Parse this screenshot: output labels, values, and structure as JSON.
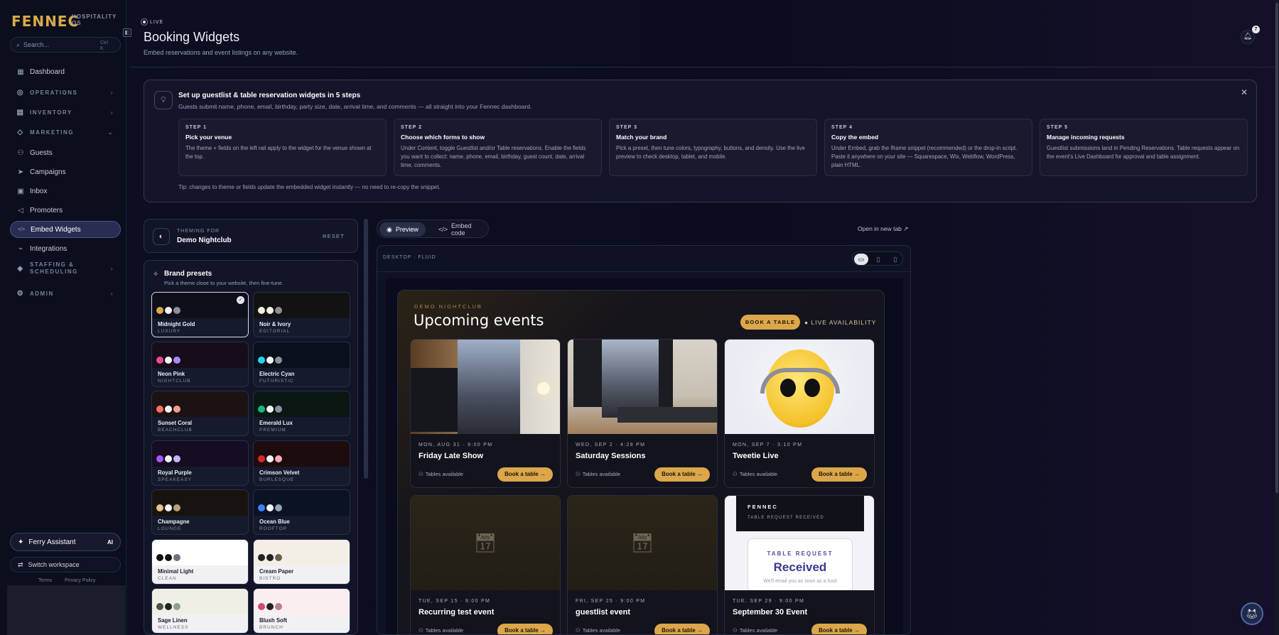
{
  "brand": {
    "logo": "FENNEC",
    "sub_line1": "HOSPITALITY",
    "sub_line2": "OS"
  },
  "search": {
    "placeholder": "Search...",
    "shortcut_line1": "Ctrl",
    "shortcut_line2": "K"
  },
  "sidebar": {
    "items": [
      {
        "label": "Dashboard",
        "icon": "grid-icon",
        "type": "item"
      },
      {
        "label": "OPERATIONS",
        "icon": "operations-icon",
        "type": "section"
      },
      {
        "label": "INVENTORY",
        "icon": "inventory-icon",
        "type": "section"
      },
      {
        "label": "MARKETING",
        "icon": "marketing-icon",
        "type": "section"
      },
      {
        "label": "Guests",
        "icon": "users-icon",
        "type": "item"
      },
      {
        "label": "Campaigns",
        "icon": "send-icon",
        "type": "item"
      },
      {
        "label": "Inbox",
        "icon": "inbox-icon",
        "type": "item"
      },
      {
        "label": "Promoters",
        "icon": "megaphone-icon",
        "type": "item"
      },
      {
        "label": "Embed Widgets",
        "icon": "code-icon",
        "type": "item",
        "active": true
      },
      {
        "label": "Integrations",
        "icon": "plug-icon",
        "type": "item"
      },
      {
        "label": "STAFFING &",
        "label2": "SCHEDULING",
        "icon": "staff-icon",
        "type": "section"
      },
      {
        "label": "ADMIN",
        "icon": "admin-icon",
        "type": "section"
      }
    ],
    "assistant": "Ferry Assistant",
    "assistant_badge": "AI",
    "switch": "Switch workspace",
    "terms": "Terms",
    "privacy": "Privacy Policy"
  },
  "header": {
    "live": "LIVE",
    "title": "Booking Widgets",
    "subtitle": "Embed reservations and event listings on any website.",
    "notifications": "7"
  },
  "setup": {
    "title": "Set up guestlist & table reservation widgets in 5 steps",
    "subtitle": "Guests submit name, phone, email, birthday, party size, date, arrival time, and comments — all straight into your Fennec dashboard.",
    "steps": [
      {
        "num": "STEP 1",
        "title": "Pick your venue",
        "desc": "The theme + fields on the left rail apply to the widget for the venue shown at the top."
      },
      {
        "num": "STEP 2",
        "title": "Choose which forms to show",
        "desc": "Under Content, toggle Guestlist and/or Table reservations. Enable the fields you want to collect: name, phone, email, birthday, guest count, date, arrival time, comments."
      },
      {
        "num": "STEP 3",
        "title": "Match your brand",
        "desc": "Pick a preset, then tune colors, typography, buttons, and density. Use the live preview to check desktop, tablet, and mobile."
      },
      {
        "num": "STEP 4",
        "title": "Copy the embed",
        "desc": "Under Embed, grab the Iframe snippet (recommended) or the drop-in script. Paste it anywhere on your site — Squarespace, Wix, Webflow, WordPress, plain HTML."
      },
      {
        "num": "STEP 5",
        "title": "Manage incoming requests",
        "desc": "Guestlist submissions land in Pending Reservations. Table requests appear on the event's Live Dashboard for approval and table assignment."
      }
    ],
    "tip": "Tip: changes to theme or fields update the embedded widget instantly — no need to re-copy the snippet."
  },
  "theming": {
    "label": "THEMING FOR",
    "venue": "Demo Nightclub",
    "reset": "RESET"
  },
  "presets": {
    "title": "Brand presets",
    "subtitle": "Pick a theme close to your website, then fine-tune.",
    "items": [
      {
        "name": "Midnight Gold",
        "tag": "LUXURY",
        "bg": "#0d0f1a",
        "colors": [
          "#d9a94a",
          "#f2f2f2",
          "#8c8f9c"
        ],
        "selected": true
      },
      {
        "name": "Noir & Ivory",
        "tag": "EDITORIAL",
        "bg": "#121212",
        "colors": [
          "#f3efe2",
          "#f3efe2",
          "#8f8f8f"
        ]
      },
      {
        "name": "Neon Pink",
        "tag": "NIGHTCLUB",
        "bg": "#170d1a",
        "colors": [
          "#ec4899",
          "#f2f2f2",
          "#a78bfa"
        ]
      },
      {
        "name": "Electric Cyan",
        "tag": "FUTURISTIC",
        "bg": "#0a0f1c",
        "colors": [
          "#22d3ee",
          "#f2f2f2",
          "#8c8f9c"
        ]
      },
      {
        "name": "Sunset Coral",
        "tag": "BEACHCLUB",
        "bg": "#1d1213",
        "colors": [
          "#f97360",
          "#f2f2f2",
          "#f0a090"
        ]
      },
      {
        "name": "Emerald Lux",
        "tag": "PREMIUM",
        "bg": "#0b1712",
        "colors": [
          "#10b981",
          "#f2f2f2",
          "#8c8f9c"
        ]
      },
      {
        "name": "Royal Purple",
        "tag": "SPEAKEASY",
        "bg": "#150d22",
        "colors": [
          "#a855f7",
          "#f2f2f2",
          "#c4b5fd"
        ]
      },
      {
        "name": "Crimson Velvet",
        "tag": "BURLESQUE",
        "bg": "#1d0c0e",
        "colors": [
          "#dc2626",
          "#f2f2f2",
          "#f9a8b4"
        ]
      },
      {
        "name": "Champagne",
        "tag": "LOUNGE",
        "bg": "#17140f",
        "colors": [
          "#e8c48a",
          "#f2f2f2",
          "#b7a07a"
        ]
      },
      {
        "name": "Ocean Blue",
        "tag": "ROOFTOP",
        "bg": "#0b1224",
        "colors": [
          "#3b82f6",
          "#f2f2f2",
          "#94a3b8"
        ]
      },
      {
        "name": "Minimal Light",
        "tag": "CLEAN",
        "bg": "#ffffff",
        "colors": [
          "#111111",
          "#111111",
          "#6b7280"
        ],
        "light": true
      },
      {
        "name": "Cream Paper",
        "tag": "BISTRO",
        "bg": "#f4efe6",
        "colors": [
          "#222222",
          "#222222",
          "#6b5e4e"
        ],
        "light": true
      },
      {
        "name": "Sage Linen",
        "tag": "WELLNESS",
        "bg": "#f0efe6",
        "colors": [
          "#445544",
          "#222222",
          "#8fa08a"
        ],
        "light": true
      },
      {
        "name": "Blush Soft",
        "tag": "BRUNCH",
        "bg": "#fbeef0",
        "colors": [
          "#d14a6b",
          "#222222",
          "#b87f8a"
        ],
        "light": true
      }
    ]
  },
  "preview": {
    "tab_preview": "Preview",
    "tab_embed": "Embed code",
    "open_new": "Open in new tab ↗",
    "device_label": "DESKTOP · FLUID"
  },
  "widget": {
    "venue": "DEMO NIGHTCLUB",
    "heading": "Upcoming events",
    "book": "BOOK A TABLE",
    "avail": "● LIVE AVAILABILITY",
    "events": [
      {
        "date": "MON, AUG 31 · 9:00 PM",
        "name": "Friday Late Show",
        "tables": "Tables available",
        "btn": "Book a table →",
        "img": "photo1"
      },
      {
        "date": "WED, SEP 2 · 4:28 PM",
        "name": "Saturday Sessions",
        "tables": "Tables available",
        "btn": "Book a table →",
        "img": "photo2"
      },
      {
        "date": "MON, SEP 7 · 3:10 PM",
        "name": "Tweetie Live",
        "tables": "Tables available",
        "btn": "Book a table →",
        "img": "chick"
      },
      {
        "date": "TUE, SEP 15 · 9:00 PM",
        "name": "Recurring test event",
        "tables": "Tables available",
        "btn": "Book a table →",
        "img": "placeholder"
      },
      {
        "date": "FRI, SEP 25 · 9:00 PM",
        "name": "guestlist event",
        "tables": "Tables available",
        "btn": "Book a table →",
        "img": "placeholder"
      },
      {
        "date": "TUE, SEP 29 · 9:00 PM",
        "name": "September 30 Event",
        "tables": "Tables available",
        "btn": "Book a table →",
        "img": "received"
      }
    ],
    "received": {
      "brand": "FENNEC",
      "sub": "TABLE REQUEST RECEIVED",
      "kicker": "TABLE REQUEST",
      "title": "Received",
      "note": "We'll email you as soon as a host"
    }
  }
}
